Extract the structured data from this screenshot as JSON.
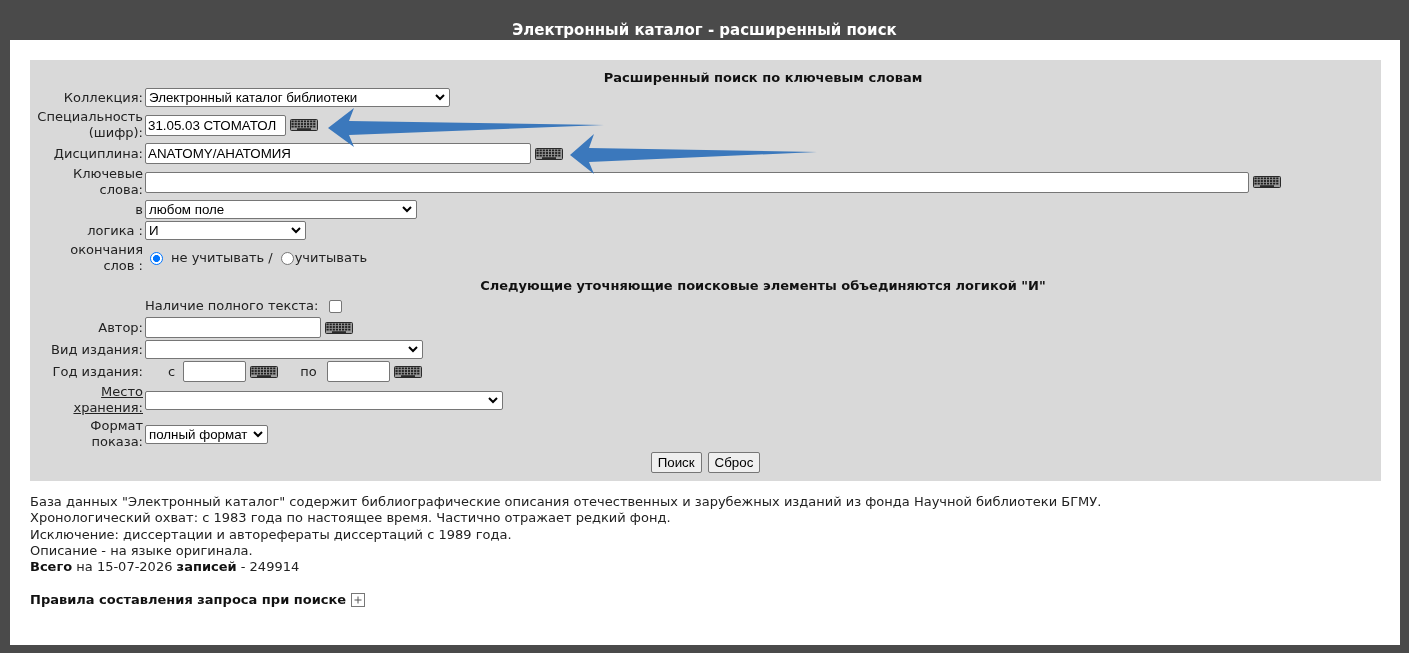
{
  "window": {
    "title": "Электронный каталог - расширенный поиск"
  },
  "search_form": {
    "heading": "Расширенный поиск по ключевым словам",
    "fields": [
      {
        "kind": "select",
        "label": "Коллекция:",
        "value": "Электронный каталог библиотеки"
      },
      {
        "kind": "text",
        "label": "Специальность (шифр):",
        "value": "31.05.03 СТОМАТОЛ",
        "keyboard": true
      },
      {
        "kind": "text",
        "label": "Дисциплина:",
        "value": "ANATOMY/АНАТОМИЯ",
        "keyboard": true
      },
      {
        "kind": "text",
        "label": "Ключевые слова:",
        "keyboard": true
      },
      {
        "kind": "select",
        "label": "в",
        "value": "любом поле"
      },
      {
        "kind": "select",
        "label": "логика :",
        "value": "И"
      },
      {
        "kind": "radio",
        "label": "окончания слов :",
        "options": [
          {
            "label": "не учитывать /",
            "selected": true
          },
          {
            "label": "учитывать",
            "selected": false
          }
        ]
      }
    ],
    "refine_heading": "Следующие уточняющие поисковые элементы объединяются логикой \"И\"",
    "refine_fields": [
      {
        "kind": "checkbox",
        "text": "Наличие полного текста:",
        "checked": false
      },
      {
        "kind": "text",
        "label": "Автор:",
        "keyboard": true
      },
      {
        "kind": "select",
        "label": "Вид издания:"
      },
      {
        "kind": "range",
        "label": "Год издания:",
        "from_label": "с",
        "to_label": "по",
        "keyboard": true
      },
      {
        "kind": "select",
        "label": "Место хранения:",
        "label_link": true
      },
      {
        "kind": "select",
        "label": "Формат показа:",
        "value": "полный формат"
      }
    ],
    "buttons": [
      "Поиск",
      "Сброс"
    ]
  },
  "info": {
    "lines": [
      "База данных \"Электронный каталог\" содержит библиографические описания отечественных и зарубежных изданий из фонда Научной библиотеки БГМУ.",
      "Хронологический охват: с 1983 года по настоящее время. Частично отражает редкий фонд.",
      "Исключение: диссертации и авторефераты диссертаций с 1989 года.",
      "Описание - на языке оригинала.",
      "**Всего** на 15-07-2026 **записей** - 249914"
    ],
    "rules": {
      "label": "Правила составления запроса при поиске",
      "expanded": false
    }
  }
}
